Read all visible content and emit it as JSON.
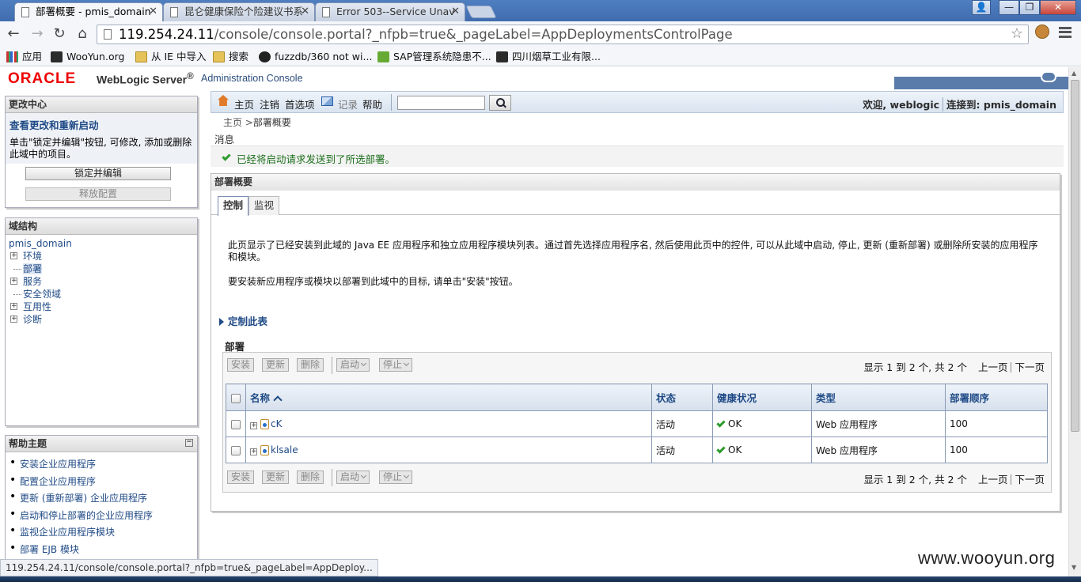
{
  "browser": {
    "tabs": [
      {
        "title": "部署概要 - pmis_domain",
        "active": true
      },
      {
        "title": "昆仑健康保险个险建议书系",
        "active": false
      },
      {
        "title": "Error 503--Service Unav",
        "active": false
      }
    ],
    "url_host": "119.254.24.11",
    "url_path": "/console/console.portal?_nfpb=true&_pageLabel=AppDeploymentsControlPage",
    "bookmarks": [
      {
        "label": "应用",
        "icon": "apps-grid-icon"
      },
      {
        "label": "WooYun.org",
        "icon": "wooyun-icon"
      },
      {
        "label": "从 IE 中导入",
        "icon": "folder-icon"
      },
      {
        "label": "搜索",
        "icon": "folder-icon"
      },
      {
        "label": "fuzzdb/360 not wi...",
        "icon": "github-icon"
      },
      {
        "label": "SAP管理系统隐患不...",
        "icon": "sap-icon"
      },
      {
        "label": "四川烟草工业有限...",
        "icon": "bookmark-icon"
      }
    ],
    "status_url": "119.254.24.11/console/console.portal?_nfpb=true&_pageLabel=AppDeploy...",
    "watermark": "www.wooyun.org"
  },
  "header": {
    "brand": "ORACLE",
    "product": "WebLogic Server",
    "reg": "®",
    "subtitle": "Administration Console"
  },
  "change_center": {
    "title": "更改中心",
    "subtitle": "查看更改和重新启动",
    "text": "单击\"锁定并编辑\"按钮, 可修改, 添加或删除此域中的项目。",
    "lock_button": "锁定并编辑",
    "release_button": "释放配置"
  },
  "domain_structure": {
    "title": "域结构",
    "root": "pmis_domain",
    "nodes": [
      {
        "label": "环境",
        "expandable": true
      },
      {
        "label": "部署",
        "expandable": false,
        "selected": true
      },
      {
        "label": "服务",
        "expandable": true
      },
      {
        "label": "安全领域",
        "expandable": false
      },
      {
        "label": "互用性",
        "expandable": true
      },
      {
        "label": "诊断",
        "expandable": true
      }
    ]
  },
  "help_topics": {
    "title": "帮助主题",
    "items": [
      "安装企业应用程序",
      "配置企业应用程序",
      "更新 (重新部署) 企业应用程序",
      "启动和停止部署的企业应用程序",
      "监视企业应用程序模块",
      "部署 EJB 模块"
    ]
  },
  "topnav": {
    "home": "主页",
    "logout": "注销",
    "preferences": "首选项",
    "record": "记录",
    "help": "帮助",
    "search_value": "",
    "welcome": "欢迎, weblogic",
    "connected": "连接到: pmis_domain"
  },
  "breadcrumb": {
    "home": "主页",
    "sep": " >",
    "current": "部署概要"
  },
  "messages": {
    "title": "消息",
    "text": "已经将启动请求发送到了所选部署。"
  },
  "summary": {
    "title": "部署概要",
    "tabs": [
      "控制",
      "监视"
    ],
    "description": "此页显示了已经安装到此域的 Java EE 应用程序和独立应用程序模块列表。通过首先选择应用程序名, 然后使用此页中的控件, 可以从此域中启动, 停止, 更新 (重新部署) 或删除所安装的应用程序和模块。",
    "install_hint": "要安装新应用程序或模块以部署到此域中的目标, 请单击\"安装\"按钮。",
    "customize": "定制此表",
    "deployments_label": "部署",
    "toolbar": {
      "install": "安装",
      "update": "更新",
      "delete": "删除",
      "start": "启动",
      "stop": "停止"
    },
    "pager": {
      "range": "显示 1 到 2 个, 共 2 个",
      "prev": "上一页",
      "next": "下一页"
    },
    "columns": [
      "名称",
      "状态",
      "健康状况",
      "类型",
      "部署顺序"
    ],
    "rows": [
      {
        "name": "cK",
        "state": "活动",
        "health": "OK",
        "type": "Web 应用程序",
        "order": "100"
      },
      {
        "name": "klsale",
        "state": "活动",
        "health": "OK",
        "type": "Web 应用程序",
        "order": "100"
      }
    ]
  }
}
